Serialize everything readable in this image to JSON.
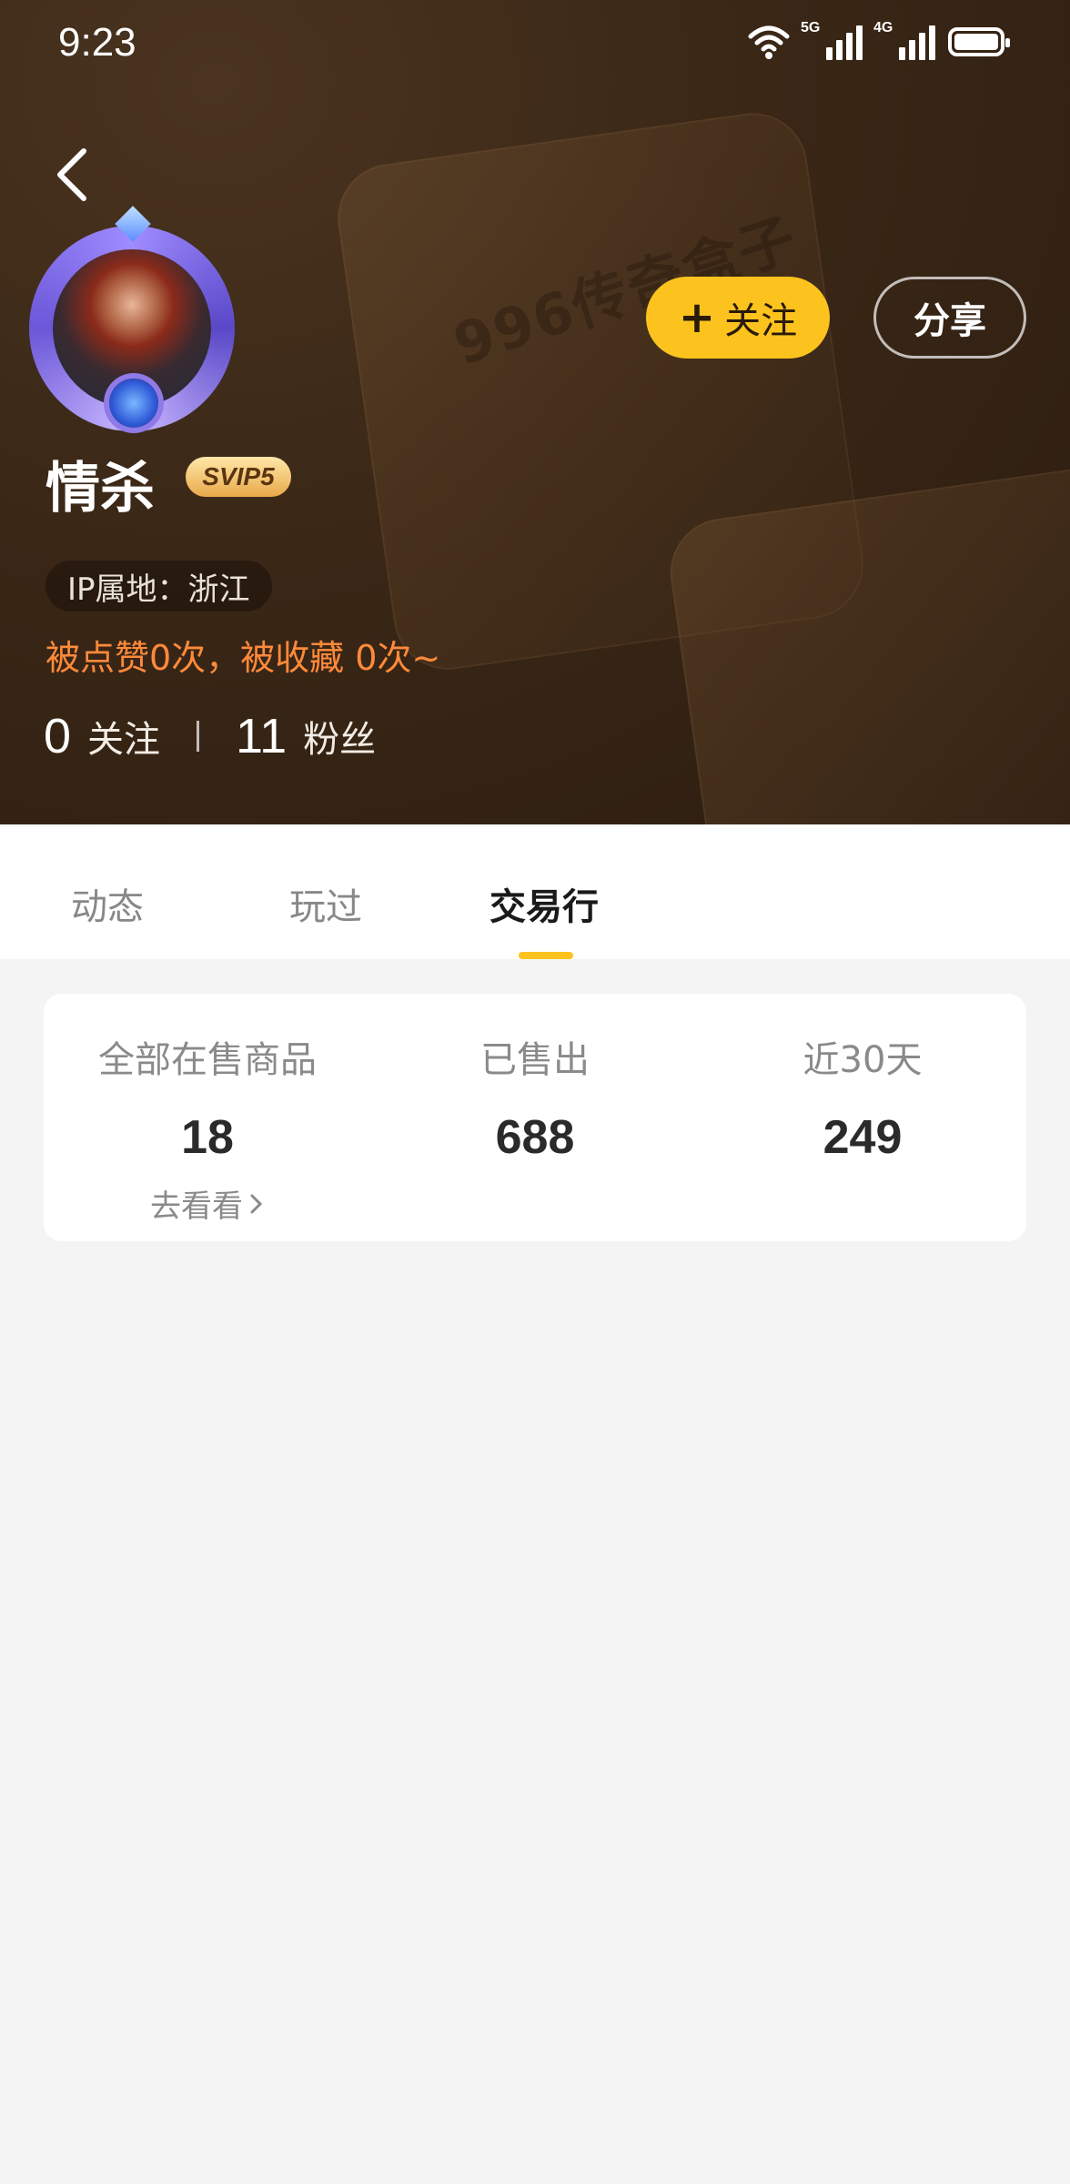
{
  "status_bar": {
    "time": "9:23",
    "network_1": "5G",
    "network_2": "4G",
    "icons": [
      "wifi-icon",
      "signal-5g-icon",
      "signal-4g-icon",
      "battery-icon"
    ]
  },
  "header": {
    "watermark_text": "996传奇盒子",
    "follow_button": {
      "plus": "+",
      "label": "关注"
    },
    "share_button": "分享",
    "username": "情杀",
    "vip_badge": "SVIP5",
    "ip_location": "IP属地：浙江",
    "likes_text": "被点赞0次，被收藏 0次~",
    "stats": {
      "following_count": "0",
      "following_label": "关注",
      "followers_count": "11",
      "followers_label": "粉丝"
    }
  },
  "tabs": [
    {
      "label": "动态",
      "active": false
    },
    {
      "label": "玩过",
      "active": false
    },
    {
      "label": "交易行",
      "active": true
    }
  ],
  "trade_summary": {
    "on_sale": {
      "title": "全部在售商品",
      "value": "18",
      "link": "去看看"
    },
    "sold": {
      "title": "已售出",
      "value": "688"
    },
    "last_30_days": {
      "title": "近30天",
      "value": "249"
    }
  },
  "colors": {
    "accent": "#fcc31e",
    "likes_text": "#ff8a3a",
    "header_bg": "#3a2716"
  }
}
